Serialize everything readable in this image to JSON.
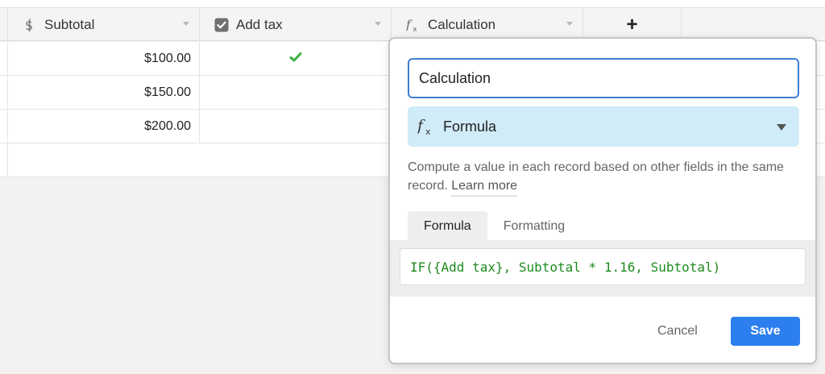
{
  "columns": [
    {
      "label": "Subtotal",
      "icon": "currency-icon"
    },
    {
      "label": "Add tax",
      "icon": "checkbox-icon"
    },
    {
      "label": "Calculation",
      "icon": "formula-icon"
    }
  ],
  "add_column_label": "+",
  "rows": [
    {
      "subtotal": "$100.00",
      "add_tax": true
    },
    {
      "subtotal": "$150.00",
      "add_tax": false
    },
    {
      "subtotal": "$200.00",
      "add_tax": false
    }
  ],
  "field_editor": {
    "name_value": "Calculation",
    "type_label": "Formula",
    "description": "Compute a value in each record based on other fields in the same record.",
    "learn_more": "Learn more",
    "tabs": [
      "Formula",
      "Formatting"
    ],
    "active_tab": "Formula",
    "formula": "IF({Add tax}, Subtotal * 1.16, Subtotal)",
    "cancel_label": "Cancel",
    "save_label": "Save"
  },
  "colors": {
    "accent": "#2d7ff0",
    "formula_text": "#1f8a1f",
    "type_select_bg": "#d0ecf8",
    "check": "#3cb043"
  }
}
